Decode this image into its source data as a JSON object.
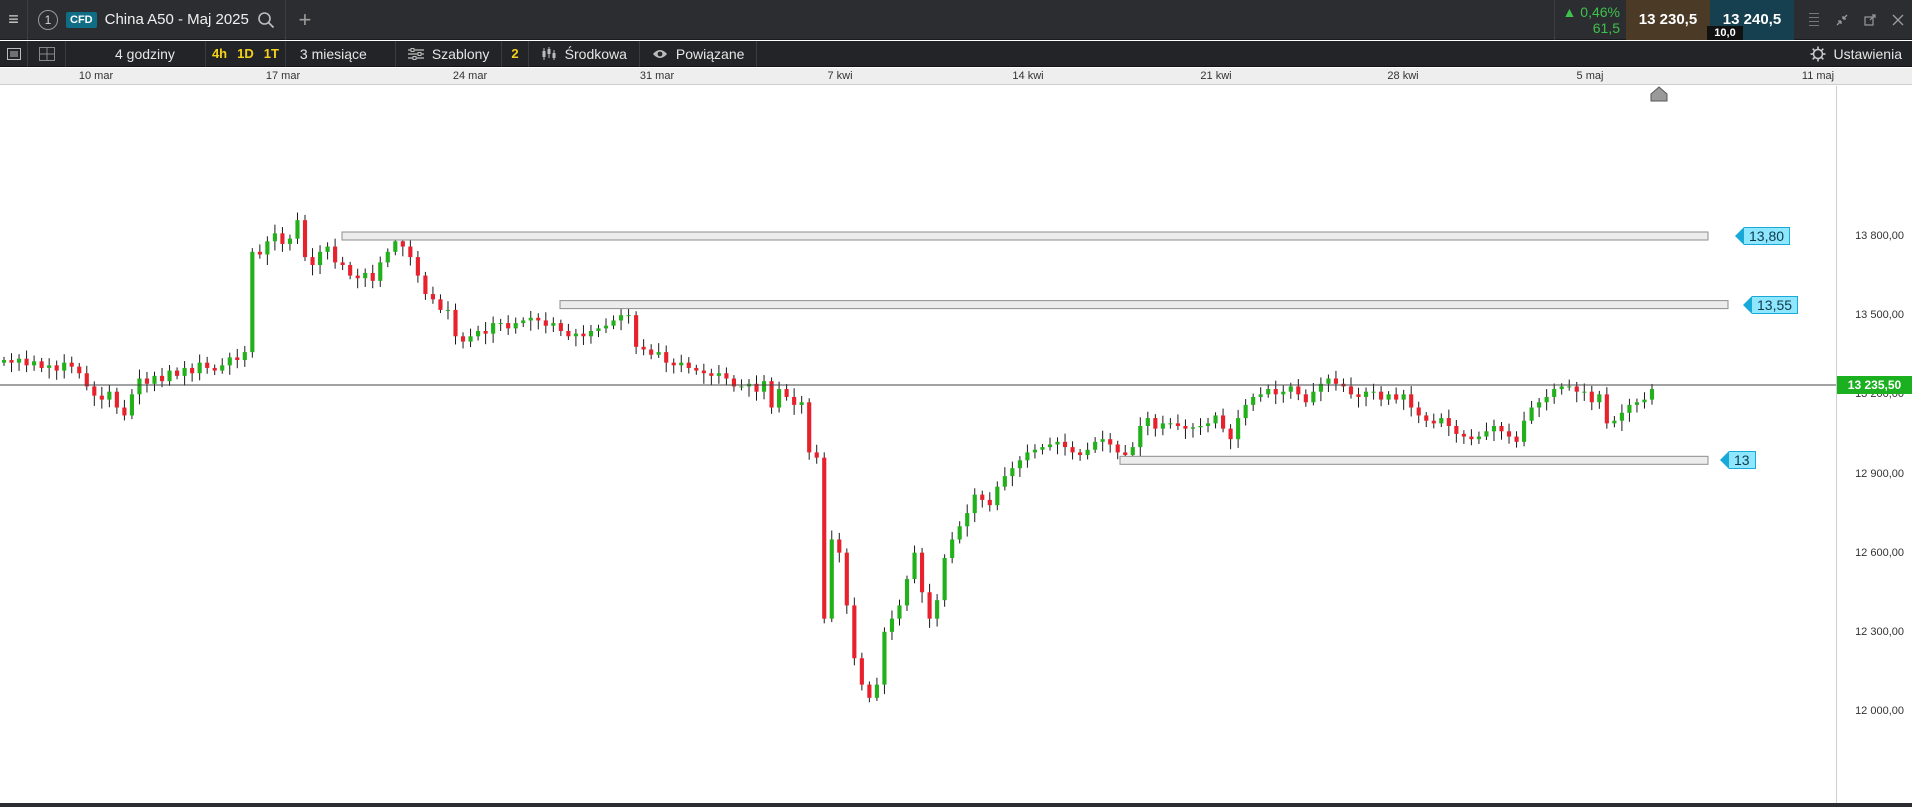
{
  "titlebar": {
    "tab_number": "1",
    "instrument_type": "CFD",
    "instrument_name": "China A50 - Maj 2025",
    "change_pct": "0,46%",
    "change_pts": "61,5",
    "sell_price": "13 230,5",
    "buy_price": "13 240,5",
    "spread": "10,0",
    "icons": [
      "menu-icon",
      "search-icon",
      "plus-icon",
      "up-triangle-icon",
      "minimize-icon",
      "popout-icon",
      "close-icon"
    ]
  },
  "toolbar": {
    "interval_label": "4 godziny",
    "quick_periods": [
      "4h",
      "1D",
      "1T"
    ],
    "range_label": "3 miesiące",
    "templates_label": "Szablony",
    "indicator_count": "2",
    "indicator_label": "Środkowa",
    "related_label": "Powiązane",
    "settings_label": "Ustawienia"
  },
  "chart_data": {
    "type": "candlestick",
    "x_axis_labels": [
      "10 mar",
      "17 mar",
      "24 mar",
      "31 mar",
      "7 kwi",
      "14 kwi",
      "21 kwi",
      "28 kwi",
      "5 maj",
      "11 maj"
    ],
    "y_axis_labels": [
      "13 800,00",
      "13 500,00",
      "13 200,00",
      "12 900,00",
      "12 600,00",
      "12 300,00",
      "12 000,00"
    ],
    "y_axis_values": [
      13800,
      13500,
      13200,
      12900,
      12600,
      12300,
      12000
    ],
    "y_range": [
      11800,
      14000
    ],
    "current_price": 13235.5,
    "current_price_label": "13 235,50",
    "alerts": [
      {
        "label": "13,80",
        "value": 13800
      },
      {
        "label": "13,55",
        "value": 13540
      },
      {
        "label": "13",
        "value": 12950
      }
    ],
    "colors": {
      "up": "#22b01b",
      "down": "#e8222c",
      "wick": "#1a1a1a",
      "price_line": "#444444",
      "alert": "#18a9d8"
    },
    "ohlc_close": [
      13330,
      13320,
      13335,
      13310,
      13325,
      13300,
      13310,
      13290,
      13320,
      13305,
      13280,
      13230,
      13195,
      13180,
      13210,
      13150,
      13120,
      13200,
      13260,
      13240,
      13270,
      13250,
      13290,
      13270,
      13300,
      13280,
      13320,
      13300,
      13290,
      13310,
      13340,
      13330,
      13360,
      13740,
      13730,
      13780,
      13810,
      13770,
      13790,
      13860,
      13720,
      13690,
      13740,
      13760,
      13700,
      13690,
      13650,
      13640,
      13660,
      13630,
      13700,
      13740,
      13780,
      13760,
      13720,
      13650,
      13580,
      13560,
      13520,
      13520,
      13420,
      13400,
      13420,
      13440,
      13430,
      13470,
      13470,
      13450,
      13470,
      13480,
      13490,
      13480,
      13460,
      13470,
      13440,
      13420,
      13430,
      13420,
      13440,
      13450,
      13460,
      13480,
      13500,
      13500,
      13380,
      13370,
      13350,
      13360,
      13320,
      13310,
      13320,
      13300,
      13290,
      13280,
      13270,
      13280,
      13260,
      13230,
      13230,
      13240,
      13210,
      13250,
      13150,
      13220,
      13190,
      13160,
      13170,
      12980,
      12960,
      12350,
      12650,
      12600,
      12400,
      12200,
      12100,
      12050,
      12100,
      12300,
      12350,
      12400,
      12500,
      12600,
      12450,
      12350,
      12420,
      12580,
      12650,
      12700,
      12750,
      12820,
      12800,
      12780,
      12850,
      12890,
      12920,
      12950,
      12980,
      12990,
      13000,
      13010,
      13020,
      13000,
      12980,
      12970,
      12990,
      13020,
      13030,
      13010,
      12980,
      12970,
      13000,
      13080,
      13110,
      13070,
      13090,
      13090,
      13080,
      13070,
      13075,
      13080,
      13090,
      13120,
      13070,
      13030,
      13110,
      13160,
      13190,
      13200,
      13220,
      13200,
      13210,
      13230,
      13200,
      13170,
      13210,
      13240,
      13260,
      13240,
      13230,
      13200,
      13190,
      13210,
      13210,
      13180,
      13200,
      13180,
      13200,
      13150,
      13120,
      13100,
      13090,
      13110,
      13080,
      13050,
      13040,
      13030,
      13040,
      13060,
      13080,
      13060,
      13040,
      13020,
      13100,
      13150,
      13170,
      13190,
      13220,
      13230,
      13230,
      13210,
      13210,
      13170,
      13200,
      13090,
      13100,
      13130,
      13160,
      13170,
      13180,
      13220
    ]
  }
}
